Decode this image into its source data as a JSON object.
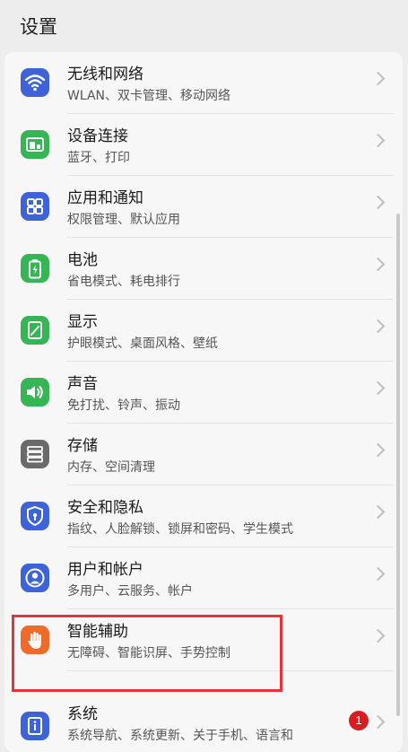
{
  "header": {
    "title": "设置"
  },
  "items": [
    {
      "title": "无线和网络",
      "subtitle": "WLAN、双卡管理、移动网络",
      "icon": "wifi-icon",
      "color": "#3E63D8"
    },
    {
      "title": "设备连接",
      "subtitle": "蓝牙、打印",
      "icon": "device-connect-icon",
      "color": "#35B553"
    },
    {
      "title": "应用和通知",
      "subtitle": "权限管理、默认应用",
      "icon": "apps-icon",
      "color": "#3E63D8"
    },
    {
      "title": "电池",
      "subtitle": "省电模式、耗电排行",
      "icon": "battery-icon",
      "color": "#35B553"
    },
    {
      "title": "显示",
      "subtitle": "护眼模式、桌面风格、壁纸",
      "icon": "display-icon",
      "color": "#35B553"
    },
    {
      "title": "声音",
      "subtitle": "免打扰、铃声、振动",
      "icon": "sound-icon",
      "color": "#35B553"
    },
    {
      "title": "存储",
      "subtitle": "内存、空间清理",
      "icon": "storage-icon",
      "color": "#6A6A6A"
    },
    {
      "title": "安全和隐私",
      "subtitle": "指纹、人脸解锁、锁屏和密码、学生模式",
      "icon": "shield-icon",
      "color": "#3E63D8"
    },
    {
      "title": "用户和帐户",
      "subtitle": "多用户、云服务、帐户",
      "icon": "user-icon",
      "color": "#3E63D8"
    },
    {
      "title": "智能辅助",
      "subtitle": "无障碍、智能识屏、手势控制",
      "icon": "hand-icon",
      "color": "#F06A2C"
    },
    {
      "title": "系统",
      "subtitle": "系统导航、系统更新、关于手机、语言和",
      "icon": "system-info-icon",
      "color": "#3E63D8"
    }
  ],
  "system_badge": "1"
}
